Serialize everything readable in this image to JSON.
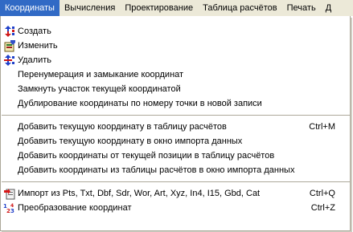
{
  "menubar": {
    "items": [
      {
        "label": "Координаты"
      },
      {
        "label": "Вычисления"
      },
      {
        "label": "Проектирование"
      },
      {
        "label": "Таблица расчётов"
      },
      {
        "label": "Печать"
      },
      {
        "label": "Д"
      }
    ]
  },
  "menu": {
    "group1": [
      {
        "label": "Создать",
        "icon": "create-icon"
      },
      {
        "label": "Изменить",
        "icon": "edit-icon"
      },
      {
        "label": "Удалить",
        "icon": "delete-icon"
      },
      {
        "label": "Перенумерация и замыкание координат"
      },
      {
        "label": "Замкнуть участок текущей координатой"
      },
      {
        "label": "Дублирование координаты по номеру точки в новой записи"
      }
    ],
    "group2": [
      {
        "label": "Добавить текущую координату в таблицу расчётов",
        "shortcut": "Ctrl+M"
      },
      {
        "label": "Добавить текущую координату в окно импорта данных"
      },
      {
        "label": "Добавить координаты от текущей позиции в таблицу расчётов"
      },
      {
        "label": "Добавить координаты из таблицы расчётов в окно импорта данных"
      }
    ],
    "group3": [
      {
        "label": "Импорт из Pts, Txt, Dbf, Sdr, Wor, Art, Xyz, In4, I15, Gbd, Cat",
        "shortcut": "Ctrl+Q",
        "icon": "import-icon"
      },
      {
        "label": "Преобразование координат",
        "shortcut": "Ctrl+Z",
        "icon": "transform-icon"
      }
    ]
  },
  "colors": {
    "highlight": "#316ac5",
    "menubar_bg": "#ece9d8",
    "separator": "#aca899"
  }
}
